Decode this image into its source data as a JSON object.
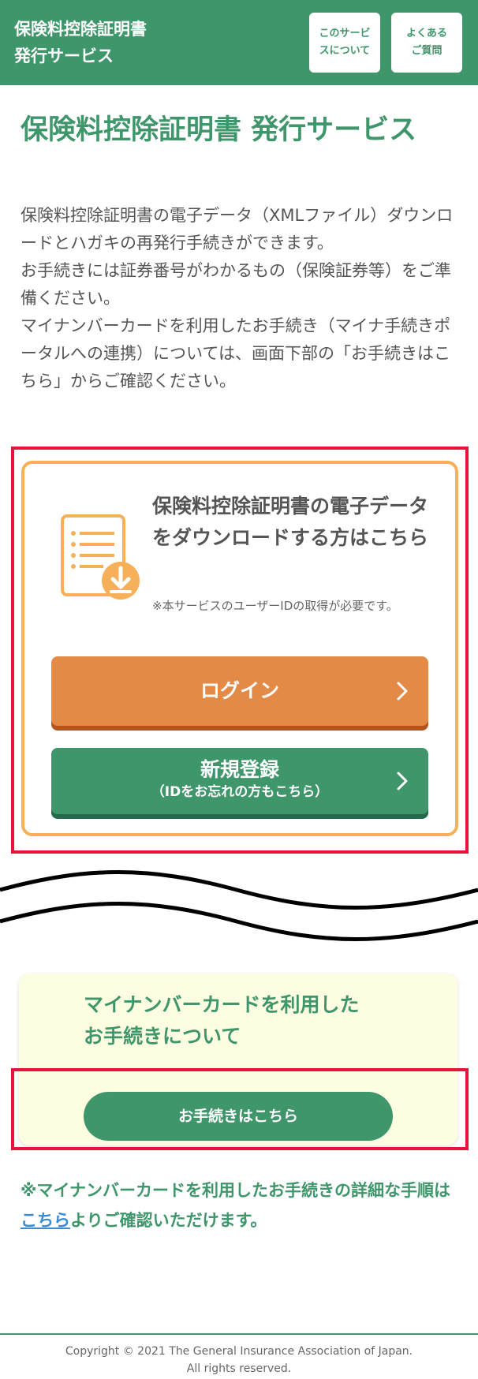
{
  "header": {
    "title_line1": "保険料控除証明書",
    "title_line2": "発行サービス",
    "about_button_line1": "このサービ",
    "about_button_line2": "スについて",
    "faq_button_line1": "よくある",
    "faq_button_line2": "ご質問"
  },
  "page_title": "保険料控除証明書 発行サービス",
  "intro": [
    "保険料控除証明書の電子データ（XMLファイル）ダウンロードとハガキの再発行手続きができます。",
    "お手続きには証券番号がわかるもの（保険証券等）をご準備ください。",
    "マイナンバーカードを利用したお手続き（マイナ手続きポータルへの連携）については、画面下部の「お手続きはこちら」からご確認ください。"
  ],
  "download_card": {
    "icon": "document-download-icon",
    "title": "保険料控除証明書の電子データをダウンロードする方はこちら",
    "note": "※本サービスのユーザーIDの取得が必要です。",
    "login_label": "ログイン",
    "register_label": "新規登録",
    "register_sublabel": "（IDをお忘れの方もこちら）"
  },
  "mynumber_card": {
    "title_line1": "マイナンバーカードを利用した",
    "title_line2": "お手続きについて",
    "button_label": "お手続きはこちら"
  },
  "footnote": {
    "before": "※マイナンバーカードを利用したお手続きの詳細な手順は",
    "link": "こちら",
    "after": "よりご確認いただけます。"
  },
  "footer": {
    "copyright_line1": "Copyright © 2021 The General Insurance Association of Japan.",
    "copyright_line2": "All rights reserved."
  },
  "colors": {
    "brand_green": "#3f966b",
    "orange": "#e48a47",
    "card_border": "#f7b05a",
    "highlight_red": "#e8123c",
    "link_blue": "#3a8ad6"
  }
}
